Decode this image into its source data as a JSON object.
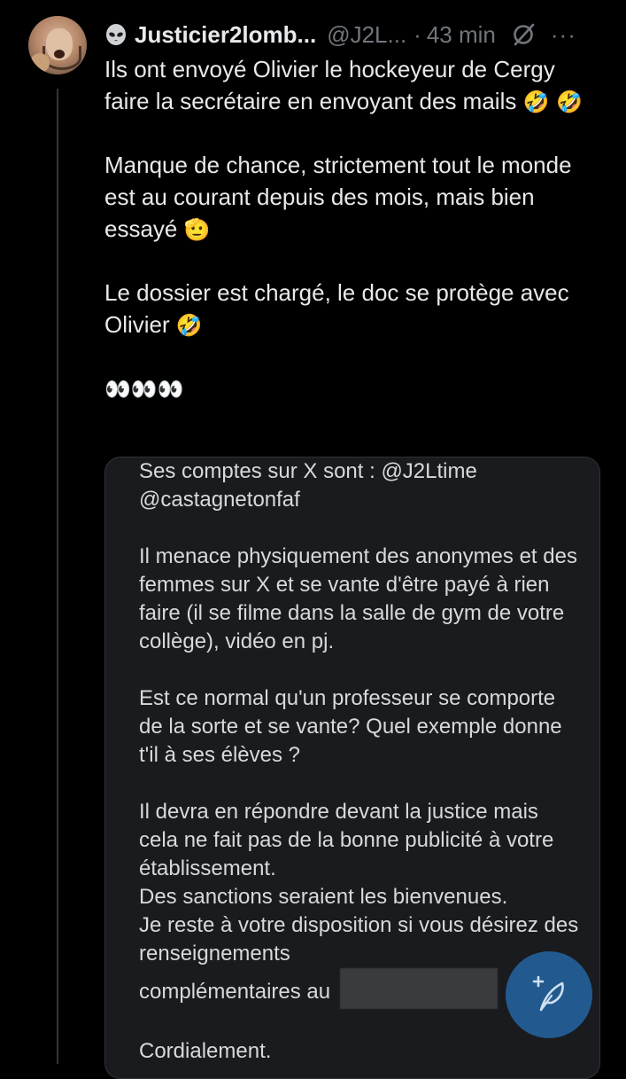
{
  "tweet": {
    "display_name": "Justicier2lomb...",
    "handle": "@J2L...",
    "separator": "·",
    "time": "43 min",
    "more": "···",
    "paragraphs": [
      {
        "text": "Ils ont envoyé Olivier le hockeyeur de Cergy faire la secrétaire en envoyant des mails",
        "emoji": "🤣 🤣"
      },
      {
        "text": "Manque de chance, strictement tout le monde est au courant depuis des mois, mais bien essayé",
        "emoji": "🫡"
      },
      {
        "text": "Le dossier est chargé, le doc se protège avec Olivier",
        "emoji": "🤣"
      }
    ],
    "eyes_emoji": "👀👀👀"
  },
  "media": {
    "lines": [
      "Ses comptes sur X sont : @J2Ltime @castagnetonfaf",
      "Il menace physiquement des anonymes et des femmes sur X et se vante d'être payé à rien faire (il se filme dans la salle de gym de votre collège), vidéo en pj.",
      "Est ce normal qu'un professeur se comporte de la sorte et se vante? Quel exemple donne t'il à ses élèves ?",
      "Il devra en répondre devant la justice mais cela ne fait pas de la bonne publicité à votre établissement.",
      "Des sanctions seraient les bienvenues.",
      "Je reste à votre disposition si vous désirez des renseignements",
      "complémentaires au",
      "Cordialement."
    ]
  },
  "compose_button": {
    "label": "compose"
  },
  "colors": {
    "background": "#000000",
    "text": "#e7e9ea",
    "muted": "#71767b",
    "fab": "#256bb0",
    "media_bg": "#1a1b1e"
  },
  "icons": [
    "alien-icon",
    "grok-slash-icon",
    "more-icon",
    "compose-feather-icon"
  ]
}
